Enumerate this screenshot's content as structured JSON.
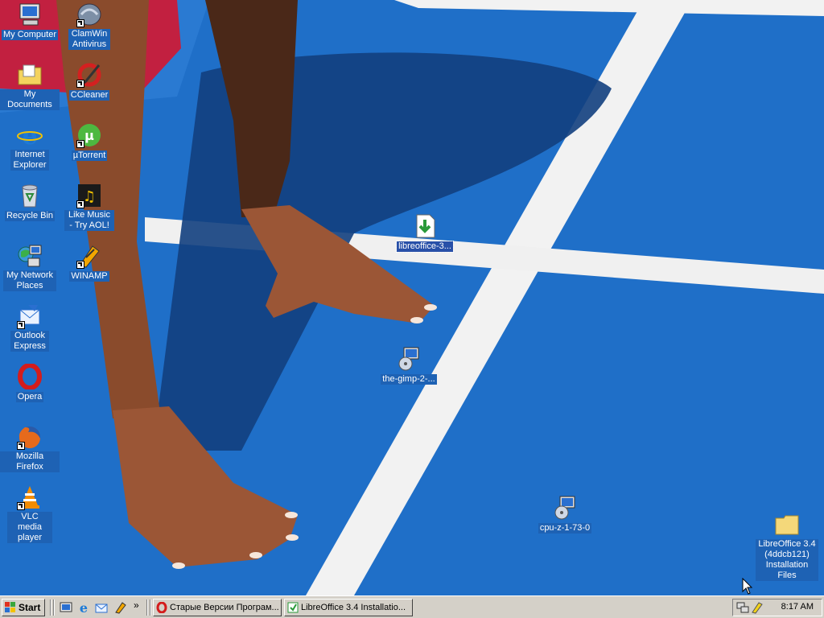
{
  "desktop": {
    "icons": [
      {
        "label": "My Computer",
        "icon": "my-computer-icon",
        "shortcut": false
      },
      {
        "label": "ClamWin Antivirus",
        "icon": "clamwin-icon",
        "shortcut": true
      },
      {
        "label": "My Documents",
        "icon": "my-documents-icon",
        "shortcut": false
      },
      {
        "label": "CCleaner",
        "icon": "ccleaner-icon",
        "shortcut": true
      },
      {
        "label": "Internet Explorer",
        "icon": "internet-explorer-icon",
        "shortcut": false
      },
      {
        "label": "µTorrent",
        "icon": "utorrent-icon",
        "shortcut": true
      },
      {
        "label": "Recycle Bin",
        "icon": "recycle-bin-icon",
        "shortcut": false
      },
      {
        "label": "Like Music - Try AOL!",
        "icon": "aol-music-icon",
        "shortcut": true
      },
      {
        "label": "My Network Places",
        "icon": "network-places-icon",
        "shortcut": false
      },
      {
        "label": "WINAMP",
        "icon": "winamp-icon",
        "shortcut": true
      },
      {
        "label": "Outlook Express",
        "icon": "outlook-express-icon",
        "shortcut": true
      },
      {
        "label": "Opera",
        "icon": "opera-icon",
        "shortcut": false
      },
      {
        "label": "Mozilla Firefox",
        "icon": "firefox-icon",
        "shortcut": true
      },
      {
        "label": "VLC media player",
        "icon": "vlc-icon",
        "shortcut": true
      },
      {
        "label": "libreoffice-3...",
        "icon": "installer-download-icon",
        "shortcut": false
      },
      {
        "label": "the-gimp-2-...",
        "icon": "setup-installer-icon",
        "shortcut": false
      },
      {
        "label": "cpu-z-1-73-0",
        "icon": "setup-installer-icon",
        "shortcut": false
      },
      {
        "label": "LibreOffice 3.4 (4ddcb121) Installation Files",
        "icon": "folder-icon",
        "shortcut": false
      }
    ]
  },
  "taskbar": {
    "start_label": "Start",
    "quick_launch": [
      "show-desktop-icon",
      "internet-explorer-icon",
      "outlook-express-icon",
      "winamp-icon"
    ],
    "overflow_label": "»",
    "tasks": [
      {
        "label": "Старые Версии Програм...",
        "icon": "opera-icon"
      },
      {
        "label": "LibreOffice 3.4 Installatio...",
        "icon": "installer-icon"
      }
    ],
    "tray_icons": [
      "network-tray-icon",
      "power-tray-icon"
    ],
    "clock": "8:17 AM"
  },
  "colors": {
    "wallpaper_blue": "#1f6fc8",
    "taskbar_gray": "#d4d0c8",
    "label_bg": "#1e62b4"
  }
}
